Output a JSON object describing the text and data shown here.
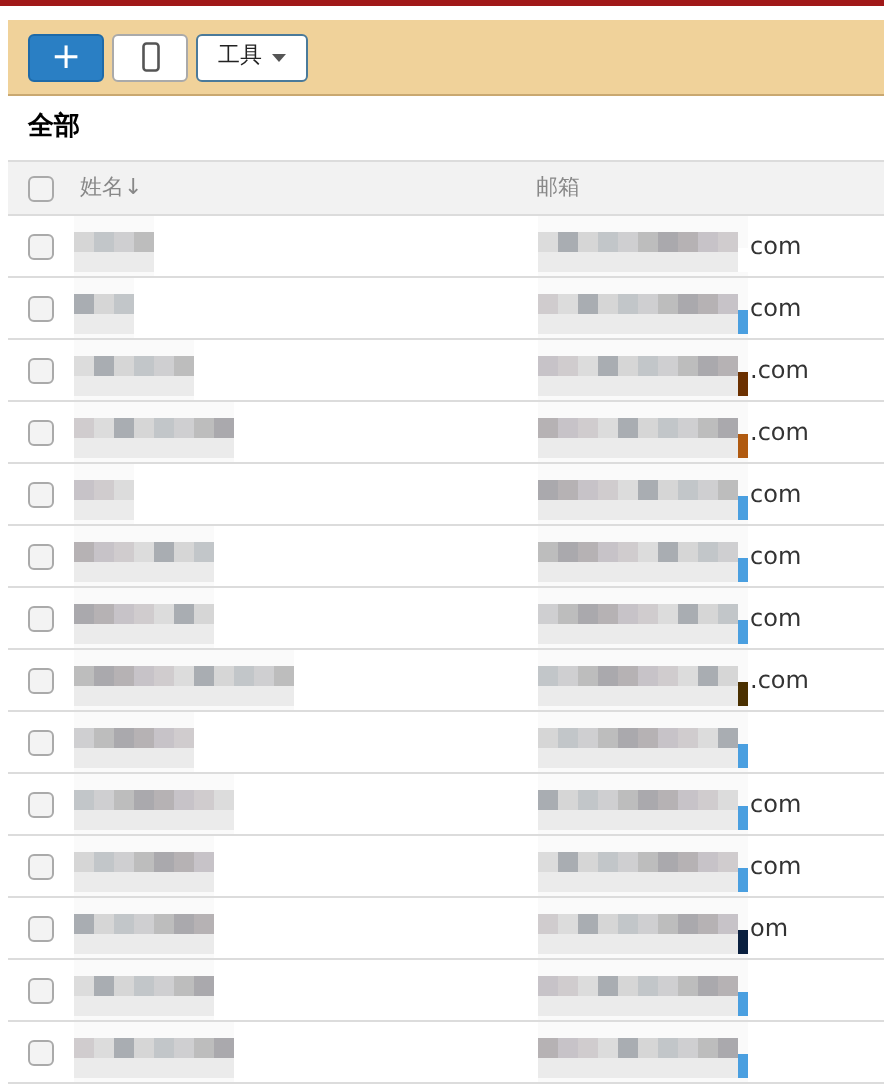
{
  "toolbar": {
    "buttons": [
      {
        "kind": "add",
        "label": "+"
      },
      {
        "kind": "phone"
      },
      {
        "kind": "menu",
        "label": "工具"
      }
    ]
  },
  "section_title": "全部",
  "table": {
    "header": {
      "checked": false,
      "columns": [
        "姓名↓",
        "邮箱"
      ]
    },
    "rows": [
      {
        "checked": false,
        "email_tail": "com",
        "color": "#ffffff"
      },
      {
        "checked": false,
        "email_tail": "com",
        "color": "#4a9fe0"
      },
      {
        "checked": false,
        "email_tail": ".com",
        "color": "#6b3000"
      },
      {
        "checked": false,
        "email_tail": ".com",
        "color": "#b05a10"
      },
      {
        "checked": false,
        "email_tail": "com",
        "color": "#4a9fe0"
      },
      {
        "checked": false,
        "email_tail": "com",
        "color": "#4a9fe0"
      },
      {
        "checked": false,
        "email_tail": "com",
        "color": "#4a9fe0"
      },
      {
        "checked": false,
        "email_tail": ".com",
        "color": "#4a3000"
      },
      {
        "checked": false,
        "color": "#4a9fe0"
      },
      {
        "checked": false,
        "email_tail": "com",
        "color": "#4a9fe0"
      },
      {
        "checked": false,
        "email_tail": "com",
        "color": "#4a9fe0"
      },
      {
        "checked": false,
        "email_tail": "om",
        "color": "#0a2040"
      },
      {
        "checked": false,
        "color": "#4a9fe0"
      },
      {
        "checked": false,
        "color": "#4a9fe0"
      }
    ]
  }
}
